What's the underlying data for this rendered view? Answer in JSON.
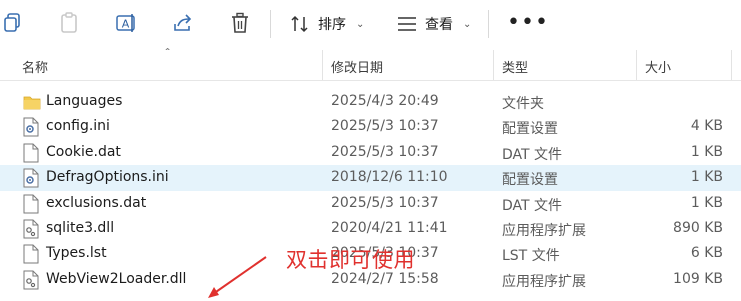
{
  "toolbar": {
    "sort_label": "排序",
    "view_label": "查看",
    "more_label": "•••"
  },
  "columns": {
    "name": "名称",
    "modified": "修改日期",
    "type": "类型",
    "size": "大小"
  },
  "files": [
    {
      "name": "Languages",
      "modified": "2025/4/3 20:49",
      "type": "文件夹",
      "size": "",
      "icon": "folder-icon"
    },
    {
      "name": "config.ini",
      "modified": "2025/5/3 10:37",
      "type": "配置设置",
      "size": "4 KB",
      "icon": "settings-file-icon"
    },
    {
      "name": "Cookie.dat",
      "modified": "2025/5/3 10:37",
      "type": "DAT 文件",
      "size": "1 KB",
      "icon": "file-icon"
    },
    {
      "name": "DefragOptions.ini",
      "modified": "2018/12/6 11:10",
      "type": "配置设置",
      "size": "1 KB",
      "icon": "settings-file-icon"
    },
    {
      "name": "exclusions.dat",
      "modified": "2025/5/3 10:37",
      "type": "DAT 文件",
      "size": "1 KB",
      "icon": "file-icon"
    },
    {
      "name": "sqlite3.dll",
      "modified": "2020/4/21 11:41",
      "type": "应用程序扩展",
      "size": "890 KB",
      "icon": "dll-file-icon"
    },
    {
      "name": "Types.lst",
      "modified": "2025/5/3 10:37",
      "type": "LST 文件",
      "size": "6 KB",
      "icon": "file-icon"
    },
    {
      "name": "WebView2Loader.dll",
      "modified": "2024/2/7 15:58",
      "type": "应用程序扩展",
      "size": "109 KB",
      "icon": "dll-file-icon"
    }
  ],
  "annotation": "双击即可使用",
  "colors": {
    "selected_row": "#e5f3fb",
    "annotation": "#e0312e",
    "folder": "#f0c040"
  }
}
